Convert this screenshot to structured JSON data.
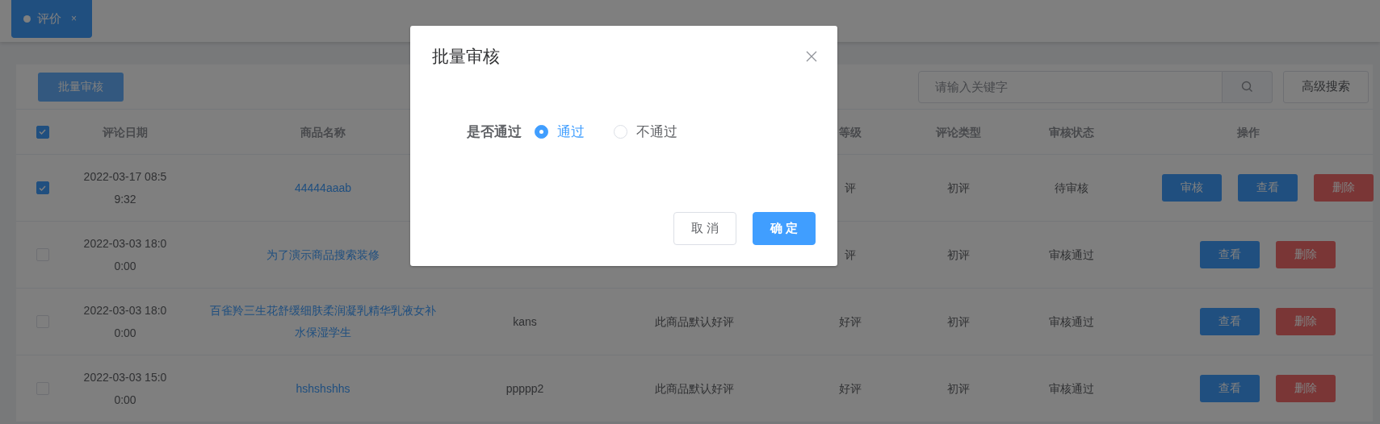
{
  "tabs": [
    {
      "label": "评价",
      "close": "×",
      "selected": true
    }
  ],
  "toolbar": {
    "batch_button": "批量审核",
    "search": {
      "placeholder": "请输入关键字"
    },
    "advanced_button": "高级搜索"
  },
  "table": {
    "header_checked": true,
    "columns": {
      "date": "评论日期",
      "product": "商品名称",
      "rating": "等级",
      "type": "评论类型",
      "status": "审核状态",
      "actions": "操作"
    },
    "rows": [
      {
        "checked": true,
        "date": "2022-03-17 08:59:32",
        "product": "44444aaab",
        "rating": "评",
        "type": "初评",
        "status": "待审核",
        "actions": [
          {
            "label": "审核",
            "kind": "primary"
          },
          {
            "label": "查看",
            "kind": "primary"
          },
          {
            "label": "删除",
            "kind": "danger"
          }
        ]
      },
      {
        "checked": false,
        "date": "2022-03-03 18:00:00",
        "product": "为了演示商品搜索装修",
        "rating": "评",
        "type": "初评",
        "status": "审核通过",
        "actions": [
          {
            "label": "查看",
            "kind": "primary"
          },
          {
            "label": "删除",
            "kind": "danger"
          }
        ]
      },
      {
        "checked": false,
        "date": "2022-03-03 18:00:00",
        "product": "百雀羚三生花舒缓细肤柔润凝乳精华乳液女补水保湿学生",
        "user": "kans",
        "content": "此商品默认好评",
        "rating": "好评",
        "type": "初评",
        "status": "审核通过",
        "actions": [
          {
            "label": "查看",
            "kind": "primary"
          },
          {
            "label": "删除",
            "kind": "danger"
          }
        ]
      },
      {
        "checked": false,
        "date": "2022-03-03 15:00:00",
        "product": "hshshshhs",
        "user": "ppppp2",
        "content": "此商品默认好评",
        "rating": "好评",
        "type": "初评",
        "status": "审核通过",
        "actions": [
          {
            "label": "查看",
            "kind": "primary"
          },
          {
            "label": "删除",
            "kind": "danger"
          }
        ]
      }
    ]
  },
  "dialog": {
    "title": "批量审核",
    "field_label": "是否通过",
    "options": [
      {
        "label": "通过",
        "selected": true
      },
      {
        "label": "不通过",
        "selected": false
      }
    ],
    "buttons": [
      {
        "label": "取 消",
        "kind": "default"
      },
      {
        "label": "确 定",
        "kind": "primary"
      }
    ]
  }
}
